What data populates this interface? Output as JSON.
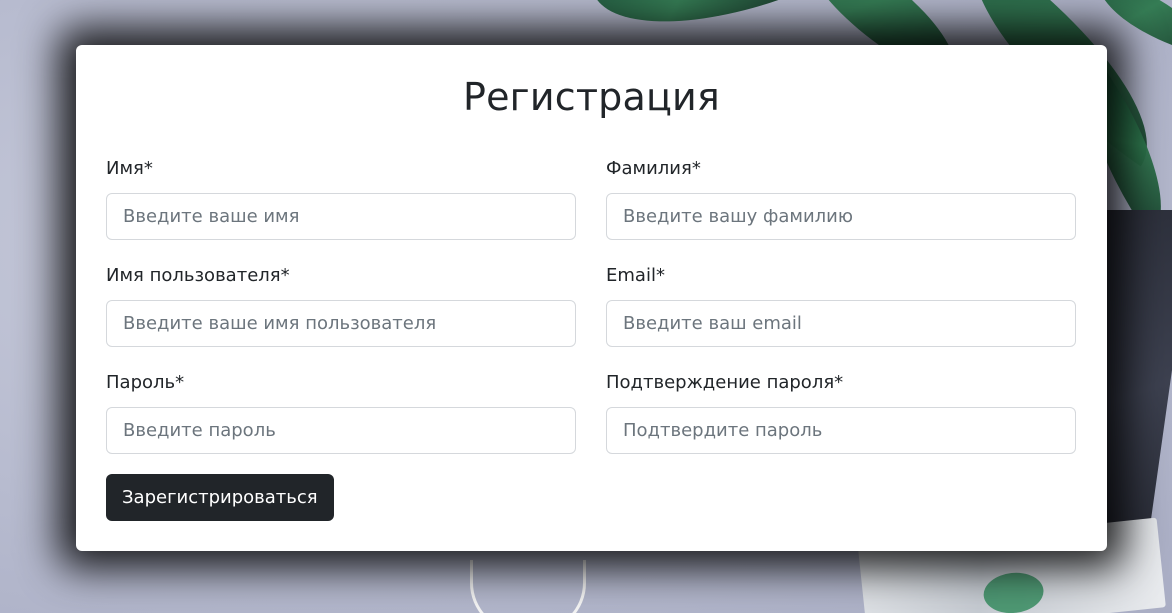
{
  "form": {
    "title": "Регистрация",
    "fields": {
      "first_name": {
        "label": "Имя*",
        "placeholder": "Введите ваше имя",
        "value": ""
      },
      "last_name": {
        "label": "Фамилия*",
        "placeholder": "Введите вашу фамилию",
        "value": ""
      },
      "username": {
        "label": "Имя пользователя*",
        "placeholder": "Введите ваше имя пользователя",
        "value": ""
      },
      "email": {
        "label": "Email*",
        "placeholder": "Введите ваш email",
        "value": ""
      },
      "password": {
        "label": "Пароль*",
        "placeholder": "Введите пароль",
        "value": ""
      },
      "password_confirm": {
        "label": "Подтверждение пароля*",
        "placeholder": "Подтвердите пароль",
        "value": ""
      }
    },
    "submit_label": "Зарегистрироваться"
  },
  "colors": {
    "button_bg": "#212529",
    "button_text": "#ffffff",
    "card_bg": "#ffffff",
    "text": "#212529",
    "placeholder": "#6c757d",
    "input_border": "#d5d8dc"
  }
}
